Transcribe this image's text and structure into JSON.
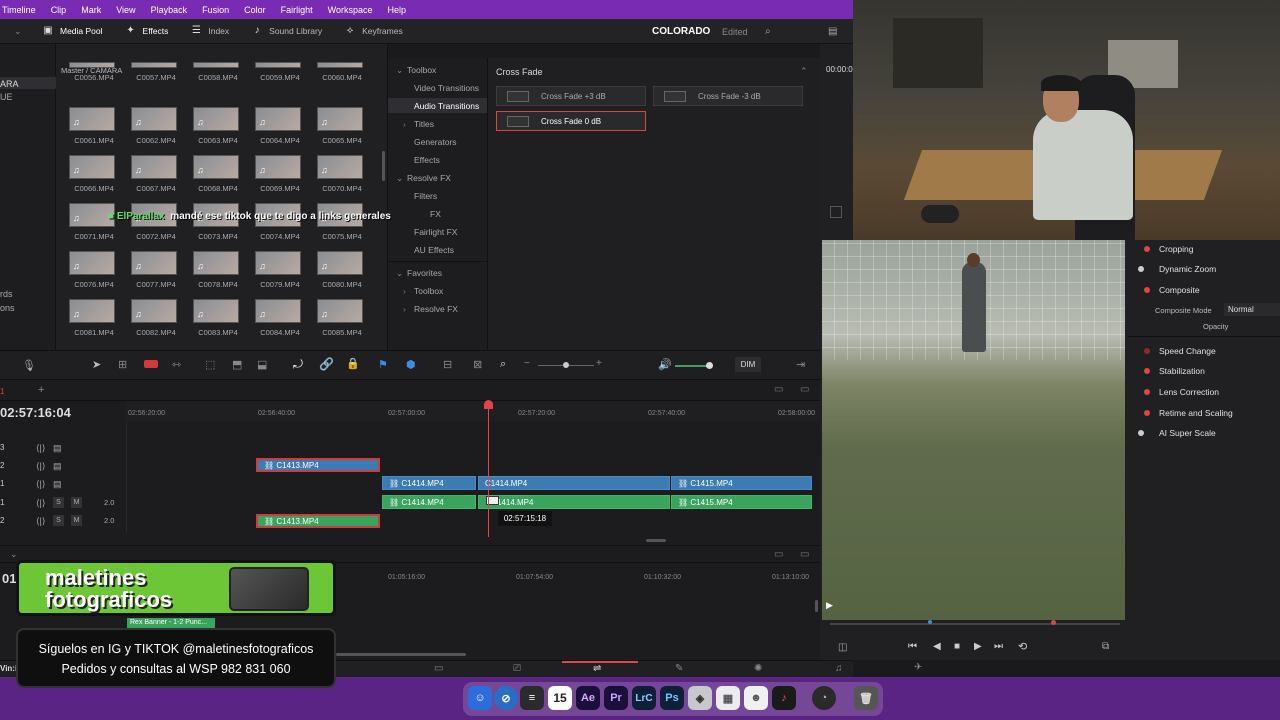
{
  "menu": [
    "Timeline",
    "Clip",
    "Mark",
    "View",
    "Playback",
    "Fusion",
    "Color",
    "Fairlight",
    "Workspace",
    "Help"
  ],
  "toolbar": {
    "media_pool": "Media Pool",
    "effects": "Effects",
    "index": "Index",
    "sound_library": "Sound Library",
    "keyframes": "Keyframes"
  },
  "project": {
    "name": "COLORADO",
    "status": "Edited"
  },
  "bin_list": [
    "ARA",
    "UE",
    "rds",
    "ons"
  ],
  "media": {
    "breadcrumb": "Master / CAMARA",
    "rows": [
      [
        "C0056.MP4",
        "C0057.MP4",
        "C0058.MP4",
        "C0059.MP4",
        "C0060.MP4"
      ],
      [
        "C0061.MP4",
        "C0062.MP4",
        "C0063.MP4",
        "C0064.MP4",
        "C0065.MP4"
      ],
      [
        "C0066.MP4",
        "C0067.MP4",
        "C0068.MP4",
        "C0069.MP4",
        "C0070.MP4"
      ],
      [
        "C0071.MP4",
        "C0072.MP4",
        "C0073.MP4",
        "C0074.MP4",
        "C0075.MP4"
      ],
      [
        "C0076.MP4",
        "C0077.MP4",
        "C0078.MP4",
        "C0079.MP4",
        "C0080.MP4"
      ],
      [
        "C0081.MP4",
        "C0082.MP4",
        "C0083.MP4",
        "C0084.MP4",
        "C0085.MP4"
      ]
    ]
  },
  "fx_tree": {
    "toolbox": "Toolbox",
    "video_transitions": "Video Transitions",
    "audio_transitions": "Audio Transitions",
    "titles": "Titles",
    "generators": "Generators",
    "effects": "Effects",
    "resolve_fx": "Resolve FX",
    "filters": "Filters",
    "ofx": "FX",
    "fairlight_fx": "Fairlight FX",
    "au_effects": "AU Effects",
    "favorites": "Favorites",
    "fav_toolbox": "Toolbox",
    "fav_resolve_fx": "Resolve FX"
  },
  "crossfade": {
    "header": "Cross Fade",
    "items": [
      "Cross Fade +3 dB",
      "Cross Fade -3 dB",
      "Cross Fade 0 dB"
    ]
  },
  "viewer": {
    "timecode": "00:00:0"
  },
  "inspector": {
    "items": [
      "Cropping",
      "Dynamic Zoom",
      "Composite",
      "Speed Change",
      "Stabilization",
      "Lens Correction",
      "Retime and Scaling",
      "AI Super Scale"
    ],
    "composite_mode_label": "Composite Mode",
    "composite_mode_value": "Normal",
    "opacity_label": "Opacity"
  },
  "timeline": {
    "timecode": "02:57:16:04",
    "ruler": [
      "02:56:20:00",
      "02:56:40:00",
      "02:57:00:00",
      "02:57:20:00",
      "02:57:40:00",
      "02:58:00:00"
    ],
    "dim": "DIM",
    "track_labels": [
      "3",
      "2",
      "1",
      "1",
      "2"
    ],
    "audio_level": "2.0",
    "clips": {
      "v2": "C1413.MP4",
      "v1a": "C1414.MP4",
      "v1b": "C1414.MP4",
      "v1c": "C1415.MP4",
      "a1a": "C1414.MP4",
      "a1b": "1414.MP4",
      "a1c": "C1415.MP4",
      "a2": "C1413.MP4"
    },
    "tooltip": "02:57:15:18"
  },
  "timeline2": {
    "ruler": [
      "01:05:16:00",
      "01:07:54:00",
      "01:10:32:00",
      "01:13:10:00"
    ],
    "timecode": "01:",
    "banner_clip": "Rex Banner - 1-2 Punc..."
  },
  "chat": {
    "user": "ElParallax",
    "message": "mandé ese tiktok que te digo a links generales"
  },
  "ad1": {
    "line1": "maletines",
    "line2": "fotograficos"
  },
  "ad2": {
    "line1": "Síguelos en IG y TIKTOK @maletinesfotograficos",
    "line2": "Pedidos y consultas al WSP 982 831 060"
  },
  "dock": {
    "items": [
      "Ae",
      "Pr",
      "LrC",
      "Ps"
    ],
    "calendar_day": "15"
  },
  "bottom_left": "Vin:i",
  "colors": {
    "menubar": "#7a2bb3",
    "dock": "#5a2484",
    "video_clip": "#3d7bb3",
    "audio_clip": "#3aa45f",
    "playhead": "#e24545",
    "ad_green": "#6dc636",
    "accent_red": "#d23a3a"
  }
}
